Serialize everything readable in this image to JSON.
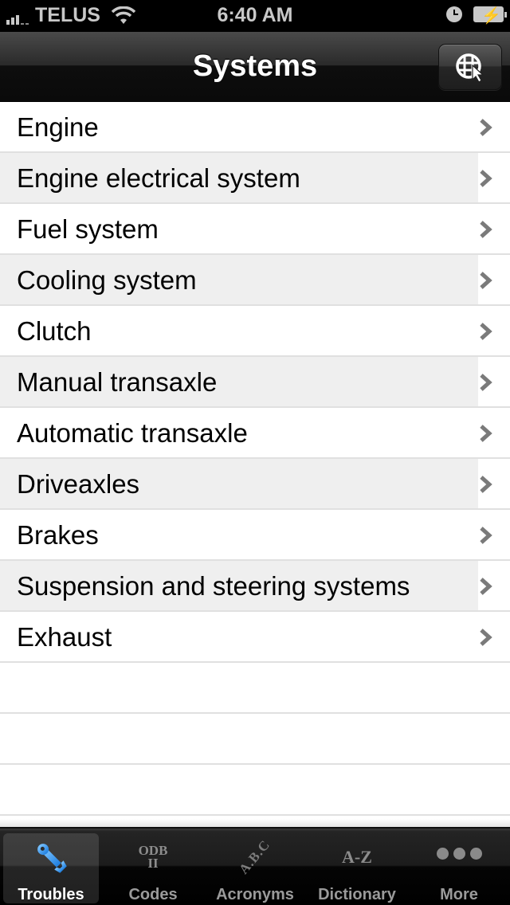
{
  "status_bar": {
    "carrier": "TELUS",
    "time": "6:40 AM",
    "signal_bars_filled": 3,
    "signal_bars_total": 5,
    "icons": [
      "signal-icon",
      "wifi-icon",
      "alarm-clock-icon",
      "battery-charging-icon"
    ]
  },
  "nav_bar": {
    "title": "Systems",
    "right_button_icon": "globe-cursor-icon"
  },
  "list": {
    "items": [
      {
        "label": "Engine"
      },
      {
        "label": "Engine electrical system"
      },
      {
        "label": "Fuel system"
      },
      {
        "label": "Cooling system"
      },
      {
        "label": "Clutch"
      },
      {
        "label": "Manual transaxle"
      },
      {
        "label": "Automatic transaxle"
      },
      {
        "label": "Driveaxles"
      },
      {
        "label": "Brakes"
      },
      {
        "label": "Suspension and steering systems"
      },
      {
        "label": "Exhaust"
      }
    ],
    "accessory_icon": "chevron-right-icon"
  },
  "tab_bar": {
    "tabs": [
      {
        "label": "Troubles",
        "icon": "wrench-icon",
        "selected": true
      },
      {
        "label": "Codes",
        "icon": "odb-ii-icon",
        "icon_text_top": "ODB",
        "icon_text_bottom": "II",
        "selected": false
      },
      {
        "label": "Acronyms",
        "icon": "abc-icon",
        "icon_text": "A.B.C",
        "selected": false
      },
      {
        "label": "Dictionary",
        "icon": "a-z-icon",
        "icon_text": "A-Z",
        "selected": false
      },
      {
        "label": "More",
        "icon": "more-dots-icon",
        "selected": false
      }
    ]
  },
  "colors": {
    "accent_blue": "#3d9be9",
    "alt_row_bg": "#efefef",
    "separator": "#e0e0e0",
    "chevron": "#7a7a7a"
  }
}
